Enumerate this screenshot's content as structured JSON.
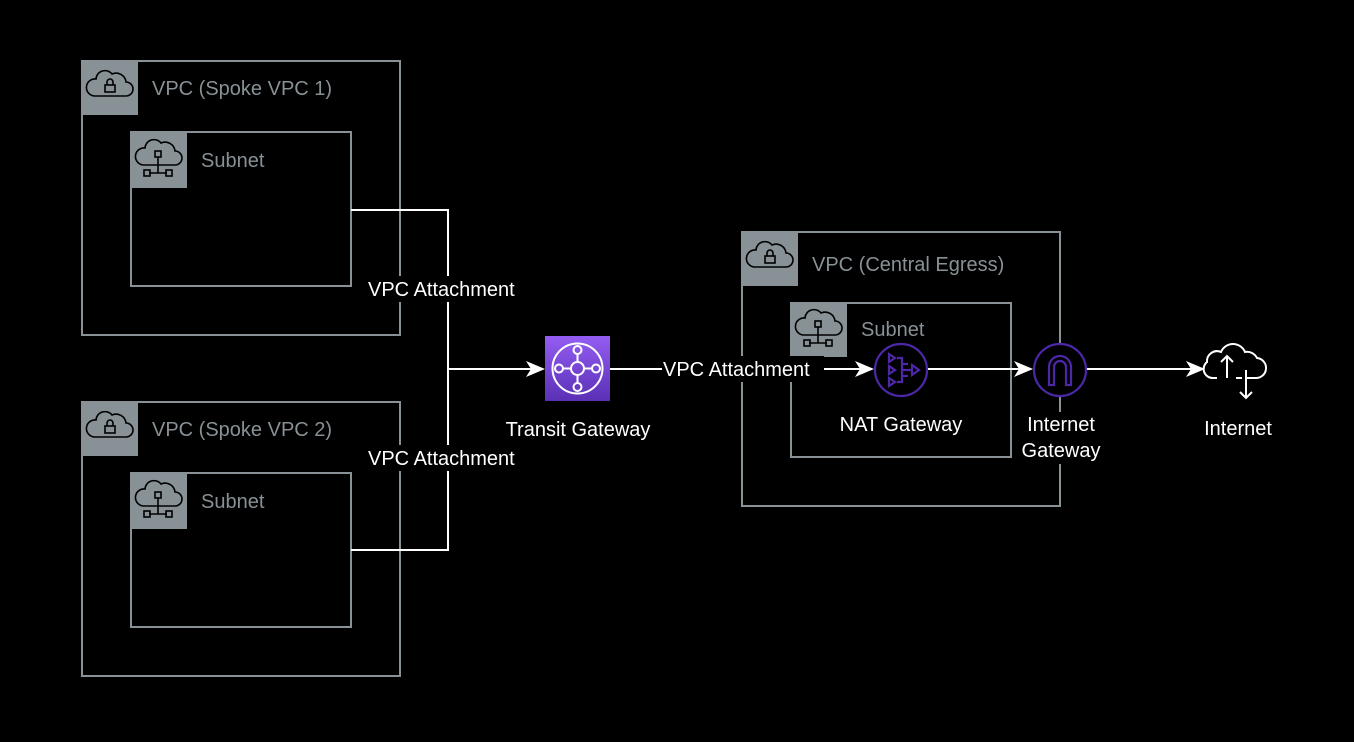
{
  "groups": {
    "spoke1": {
      "title": "VPC (Spoke VPC 1)",
      "icon": "vpc-lock-cloud-icon",
      "subnet": {
        "title": "Subnet",
        "icon": "subnet-cloud-icon"
      }
    },
    "spoke2": {
      "title": "VPC (Spoke VPC 2)",
      "icon": "vpc-lock-cloud-icon",
      "subnet": {
        "title": "Subnet",
        "icon": "subnet-cloud-icon"
      }
    },
    "egress": {
      "title": "VPC (Central Egress)",
      "icon": "vpc-lock-cloud-icon",
      "subnet": {
        "title": "Subnet",
        "icon": "subnet-cloud-icon"
      }
    }
  },
  "nodes": {
    "transit_gateway": {
      "label": "Transit Gateway",
      "icon": "transit-gateway-icon",
      "color": "#7b4ee3"
    },
    "nat_gateway": {
      "label": "NAT Gateway",
      "icon": "nat-gateway-icon",
      "color": "#4d27aa"
    },
    "internet_gateway": {
      "label_line1": "Internet",
      "label_line2": "Gateway",
      "icon": "internet-gateway-icon",
      "color": "#4d27aa"
    },
    "internet": {
      "label": "Internet",
      "icon": "internet-cloud-icon"
    }
  },
  "edges": {
    "spoke1_attachment": "VPC Attachment",
    "spoke2_attachment": "VPC Attachment",
    "egress_attachment": "VPC Attachment"
  },
  "colors": {
    "background": "#000000",
    "group_border": "#879196",
    "edge": "#ffffff"
  }
}
